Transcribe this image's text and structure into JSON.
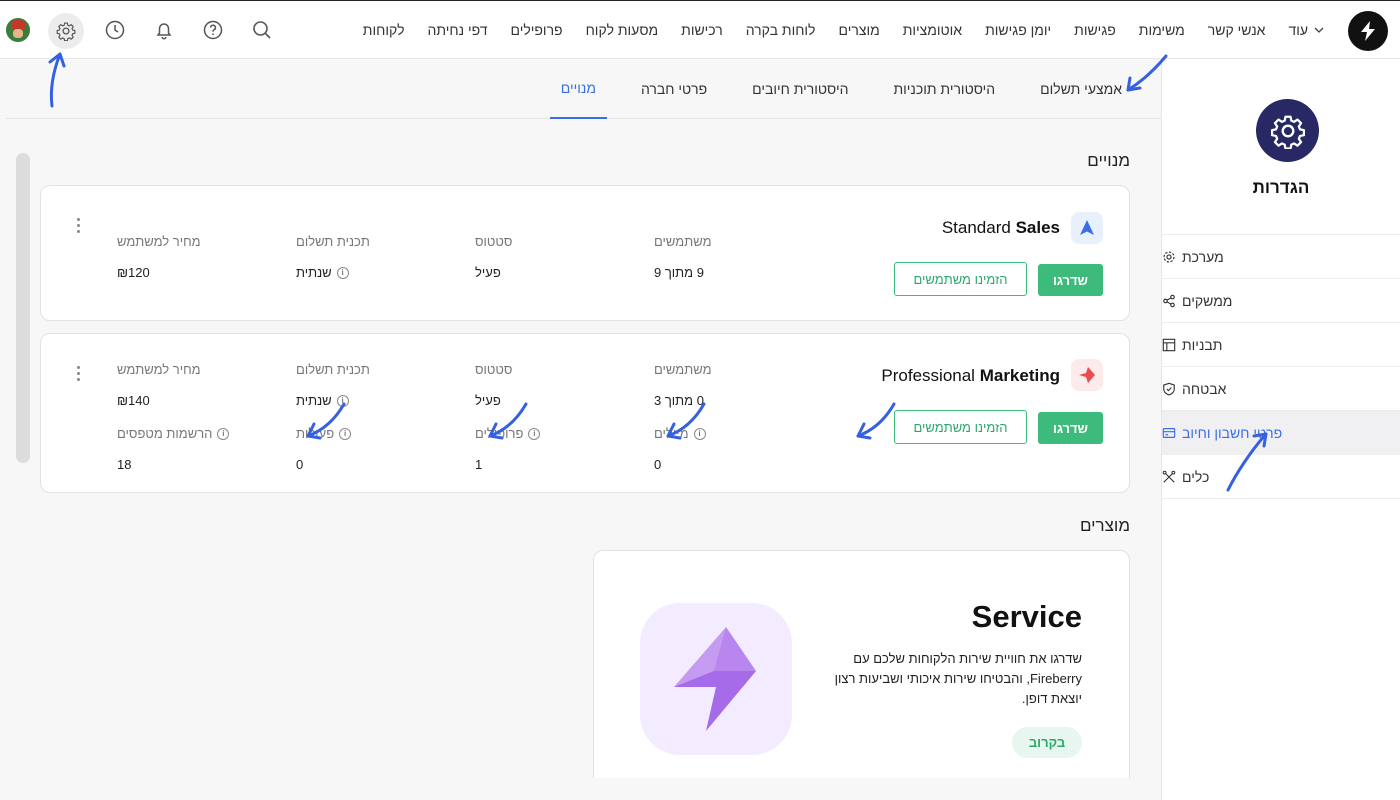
{
  "topnav": {
    "items": [
      "לקוחות",
      "דפי נחיתה",
      "פרופילים",
      "מסעות לקוח",
      "רכישות",
      "לוחות בקרה",
      "מוצרים",
      "אוטומציות",
      "יומן פגישות",
      "פגישות",
      "משימות",
      "אנשי קשר"
    ],
    "more_label": "עוד"
  },
  "sidebar": {
    "title": "הגדרות",
    "items": [
      {
        "label": "מערכת",
        "icon": "gear-icon"
      },
      {
        "label": "ממשקים",
        "icon": "share-icon"
      },
      {
        "label": "תבניות",
        "icon": "layout-icon"
      },
      {
        "label": "אבטחה",
        "icon": "shield-icon"
      },
      {
        "label": "פרטי חשבון וחיוב",
        "icon": "card-icon",
        "active": true
      },
      {
        "label": "כלים",
        "icon": "tools-icon"
      }
    ]
  },
  "tabs": [
    "מנויים",
    "פרטי חברה",
    "היסטורית חיובים",
    "היסטורית תוכניות",
    "אמצעי תשלום"
  ],
  "subscriptions_title": "מנויים",
  "subscriptions": [
    {
      "name_bold": "Sales",
      "name_regular": "Standard",
      "icon_color": "#3a6ee8",
      "upgrade_label": "שדרגו",
      "invite_label": "הזמינו משתמשים",
      "fields": [
        {
          "label": "משתמשים",
          "value": "9 מתוך 9"
        },
        {
          "label": "סטטוס",
          "value": "פעיל"
        },
        {
          "label": "תכנית תשלום",
          "value": "שנתית"
        },
        {
          "label": "מחיר למשתמש",
          "value": "₪120"
        }
      ]
    },
    {
      "name_bold": "Marketing",
      "name_regular": "Professional",
      "icon_color": "#e84c4c",
      "upgrade_label": "שדרגו",
      "invite_label": "הזמינו משתמשים",
      "fields": [
        {
          "label": "משתמשים",
          "value": "0 מתוך 3"
        },
        {
          "label": "סטטוס",
          "value": "פעיל"
        },
        {
          "label": "תכנית תשלום",
          "value": "שנתית"
        },
        {
          "label": "מחיר למשתמש",
          "value": "₪140"
        }
      ],
      "usage": [
        {
          "label": "מיילים",
          "value": "0"
        },
        {
          "label": "פרופילים",
          "value": "1"
        },
        {
          "label": "פעולות",
          "value": "0"
        },
        {
          "label": "הרשמות מטפסים",
          "value": "18"
        }
      ]
    }
  ],
  "products_title": "מוצרים",
  "product": {
    "title": "Service",
    "description": "שדרגו את חוויית שירות הלקוחות שלכם עם Fireberry, והבטיחו שירות איכותי ושביעות רצון יוצאת דופן.",
    "badge": "בקרוב"
  },
  "colors": {
    "accent": "#3a6ee8",
    "green": "#3dbb7c",
    "settings_bg": "#272864"
  }
}
